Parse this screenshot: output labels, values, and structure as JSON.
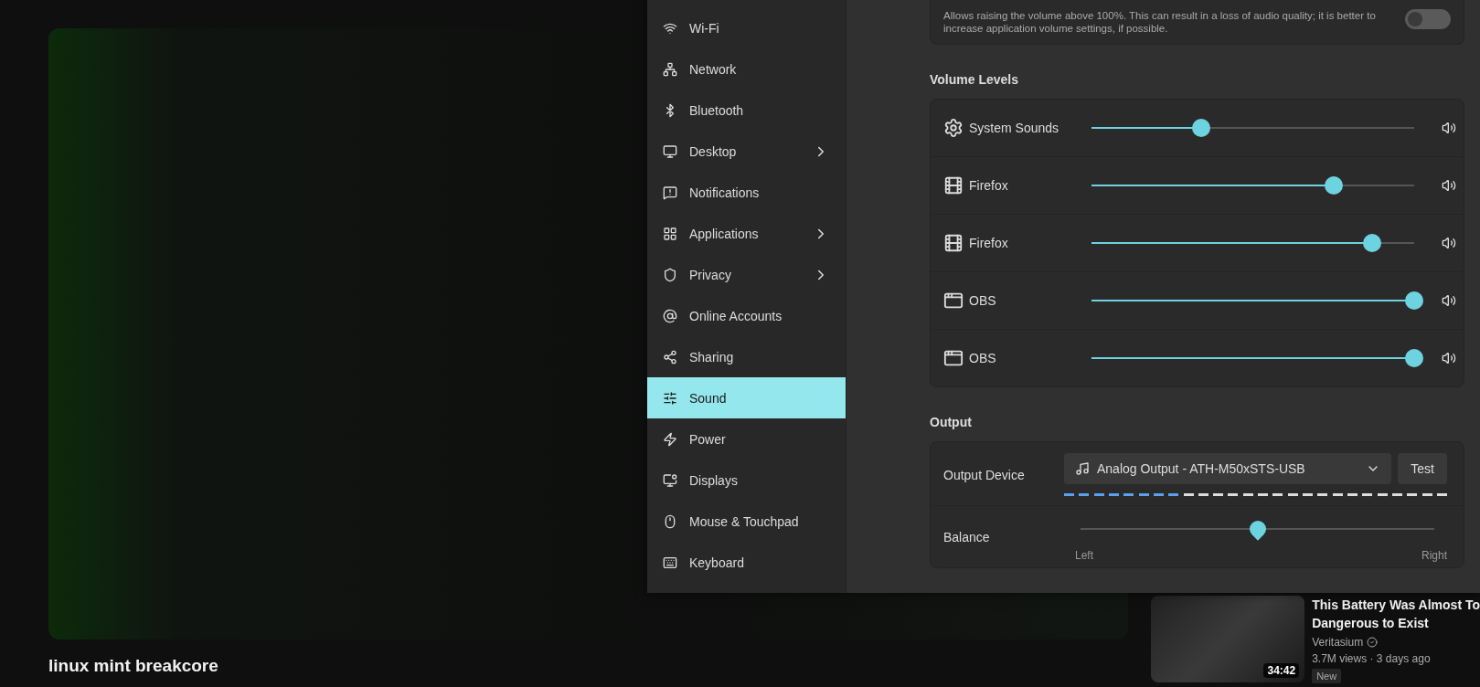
{
  "video": {
    "title": "linux mint breakcore"
  },
  "settings": {
    "sidebar": {
      "items": [
        {
          "label": "Wi-Fi",
          "selected": false,
          "has_submenu": false
        },
        {
          "label": "Network",
          "selected": false,
          "has_submenu": false
        },
        {
          "label": "Bluetooth",
          "selected": false,
          "has_submenu": false
        },
        {
          "label": "Desktop",
          "selected": false,
          "has_submenu": true
        },
        {
          "label": "Notifications",
          "selected": false,
          "has_submenu": false
        },
        {
          "label": "Applications",
          "selected": false,
          "has_submenu": true
        },
        {
          "label": "Privacy",
          "selected": false,
          "has_submenu": true
        },
        {
          "label": "Online Accounts",
          "selected": false,
          "has_submenu": false
        },
        {
          "label": "Sharing",
          "selected": false,
          "has_submenu": false
        },
        {
          "label": "Sound",
          "selected": true,
          "has_submenu": false
        },
        {
          "label": "Power",
          "selected": false,
          "has_submenu": false
        },
        {
          "label": "Displays",
          "selected": false,
          "has_submenu": false
        },
        {
          "label": "Mouse & Touchpad",
          "selected": false,
          "has_submenu": false
        },
        {
          "label": "Keyboard",
          "selected": false,
          "has_submenu": false
        }
      ]
    },
    "overamplification": {
      "description": "Allows raising the volume above 100%. This can result in a loss of audio quality; it is better to increase application volume settings, if possible.",
      "on": false
    },
    "volume_levels": {
      "heading": "Volume Levels",
      "streams": [
        {
          "name": "System Sounds",
          "level": 0.34
        },
        {
          "name": "Firefox",
          "level": 0.75
        },
        {
          "name": "Firefox",
          "level": 0.87
        },
        {
          "name": "OBS",
          "level": 1.0
        },
        {
          "name": "OBS",
          "level": 1.0
        }
      ]
    },
    "output": {
      "heading": "Output",
      "device_label": "Output Device",
      "device": "Analog Output - ATH-M50xSTS-USB",
      "test_button": "Test",
      "meter": {
        "level": 0.31
      },
      "balance": {
        "label": "Balance",
        "level": 0.5,
        "left": "Left",
        "right": "Right"
      }
    }
  },
  "suggestion": {
    "title_lines": [
      "This Battery Was Almost To",
      "Dangerous to Exist"
    ],
    "duration": "34:42",
    "channel": "Veritasium",
    "verified": true,
    "meta": "3.7M views · 3 days ago",
    "badge": "New"
  }
}
